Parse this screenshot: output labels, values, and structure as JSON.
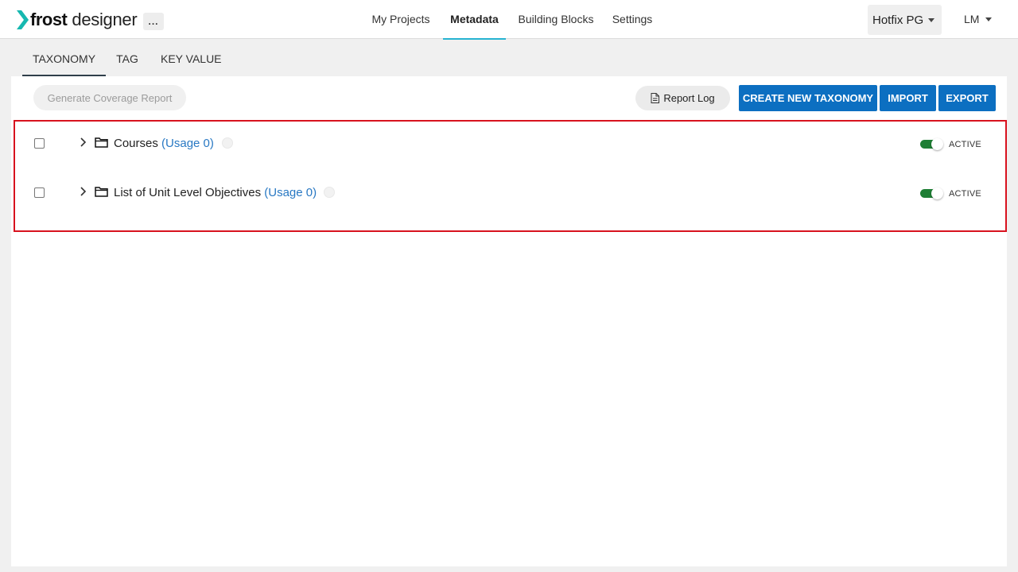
{
  "app": {
    "logo_bold": "frost",
    "logo_light": "designer",
    "more_label": "..."
  },
  "nav": {
    "items": [
      {
        "label": "My Projects"
      },
      {
        "label": "Metadata"
      },
      {
        "label": "Building Blocks"
      },
      {
        "label": "Settings"
      }
    ],
    "active": "Metadata"
  },
  "org": {
    "label": "Hotfix PG"
  },
  "user": {
    "initials": "LM"
  },
  "subtabs": {
    "items": [
      {
        "label": "TAXONOMY"
      },
      {
        "label": "TAG"
      },
      {
        "label": "KEY VALUE"
      }
    ],
    "active": "TAXONOMY"
  },
  "toolbar": {
    "coverage_label": "Generate Coverage Report",
    "report_log_label": "Report Log",
    "create_label": "CREATE NEW TAXONOMY",
    "import_label": "IMPORT",
    "export_label": "EXPORT"
  },
  "taxonomies": [
    {
      "name": "Courses",
      "usage": "(Usage 0)",
      "status": "ACTIVE",
      "active": true
    },
    {
      "name": "List of Unit Level Objectives",
      "usage": "(Usage 0)",
      "status": "ACTIVE",
      "active": true
    }
  ],
  "colors": {
    "primary": "#0c6fc1",
    "nav_accent": "#26b3d1",
    "toggle_on": "#1e7e34",
    "highlight": "#d8121e",
    "usage_link": "#2878c3"
  }
}
